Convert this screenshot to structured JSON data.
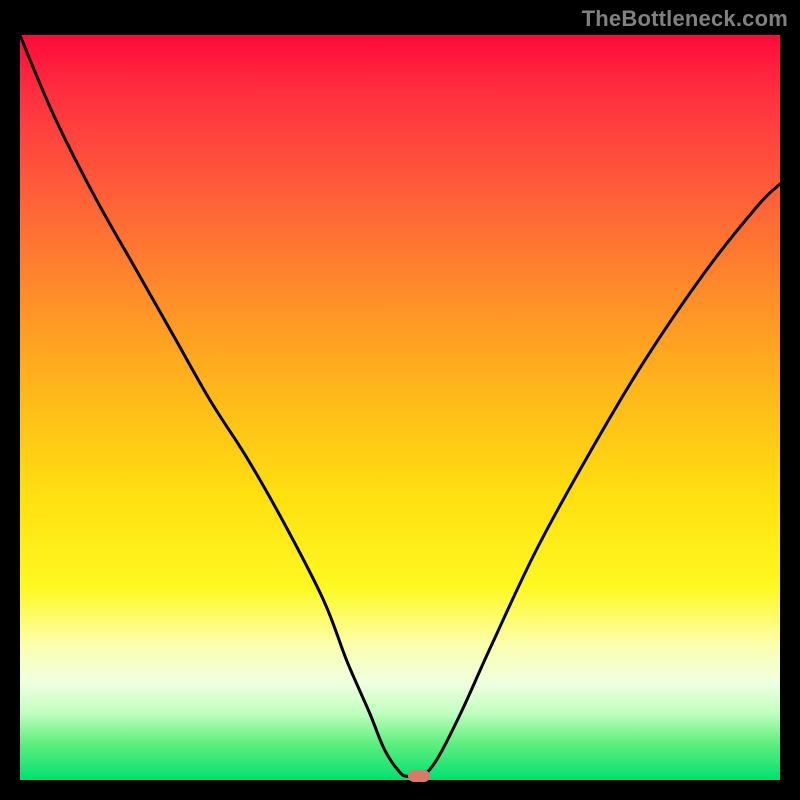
{
  "watermark": "TheBottleneck.com",
  "chart_data": {
    "type": "line",
    "title": "",
    "xlabel": "",
    "ylabel": "",
    "xlim": [
      0,
      100
    ],
    "ylim": [
      0,
      100
    ],
    "x": [
      0,
      2,
      5,
      10,
      15,
      20,
      25,
      30,
      35,
      40,
      43,
      46,
      48,
      50,
      51,
      52,
      53,
      55,
      58,
      62,
      68,
      75,
      82,
      90,
      97,
      100
    ],
    "y": [
      100,
      95,
      88,
      78,
      69,
      60,
      51,
      43,
      34,
      24,
      16,
      9,
      4,
      1,
      0.5,
      0.5,
      0.5,
      3,
      9,
      18,
      31,
      44,
      56,
      68,
      77,
      80
    ],
    "marker": {
      "x": 52.5,
      "y": 0.5
    },
    "gradient_stops": [
      {
        "pos": 0,
        "color": "#ff0a3a"
      },
      {
        "pos": 20,
        "color": "#ff5a3a"
      },
      {
        "pos": 48,
        "color": "#ffb81a"
      },
      {
        "pos": 74,
        "color": "#fff820"
      },
      {
        "pos": 100,
        "color": "#00e070"
      }
    ]
  }
}
